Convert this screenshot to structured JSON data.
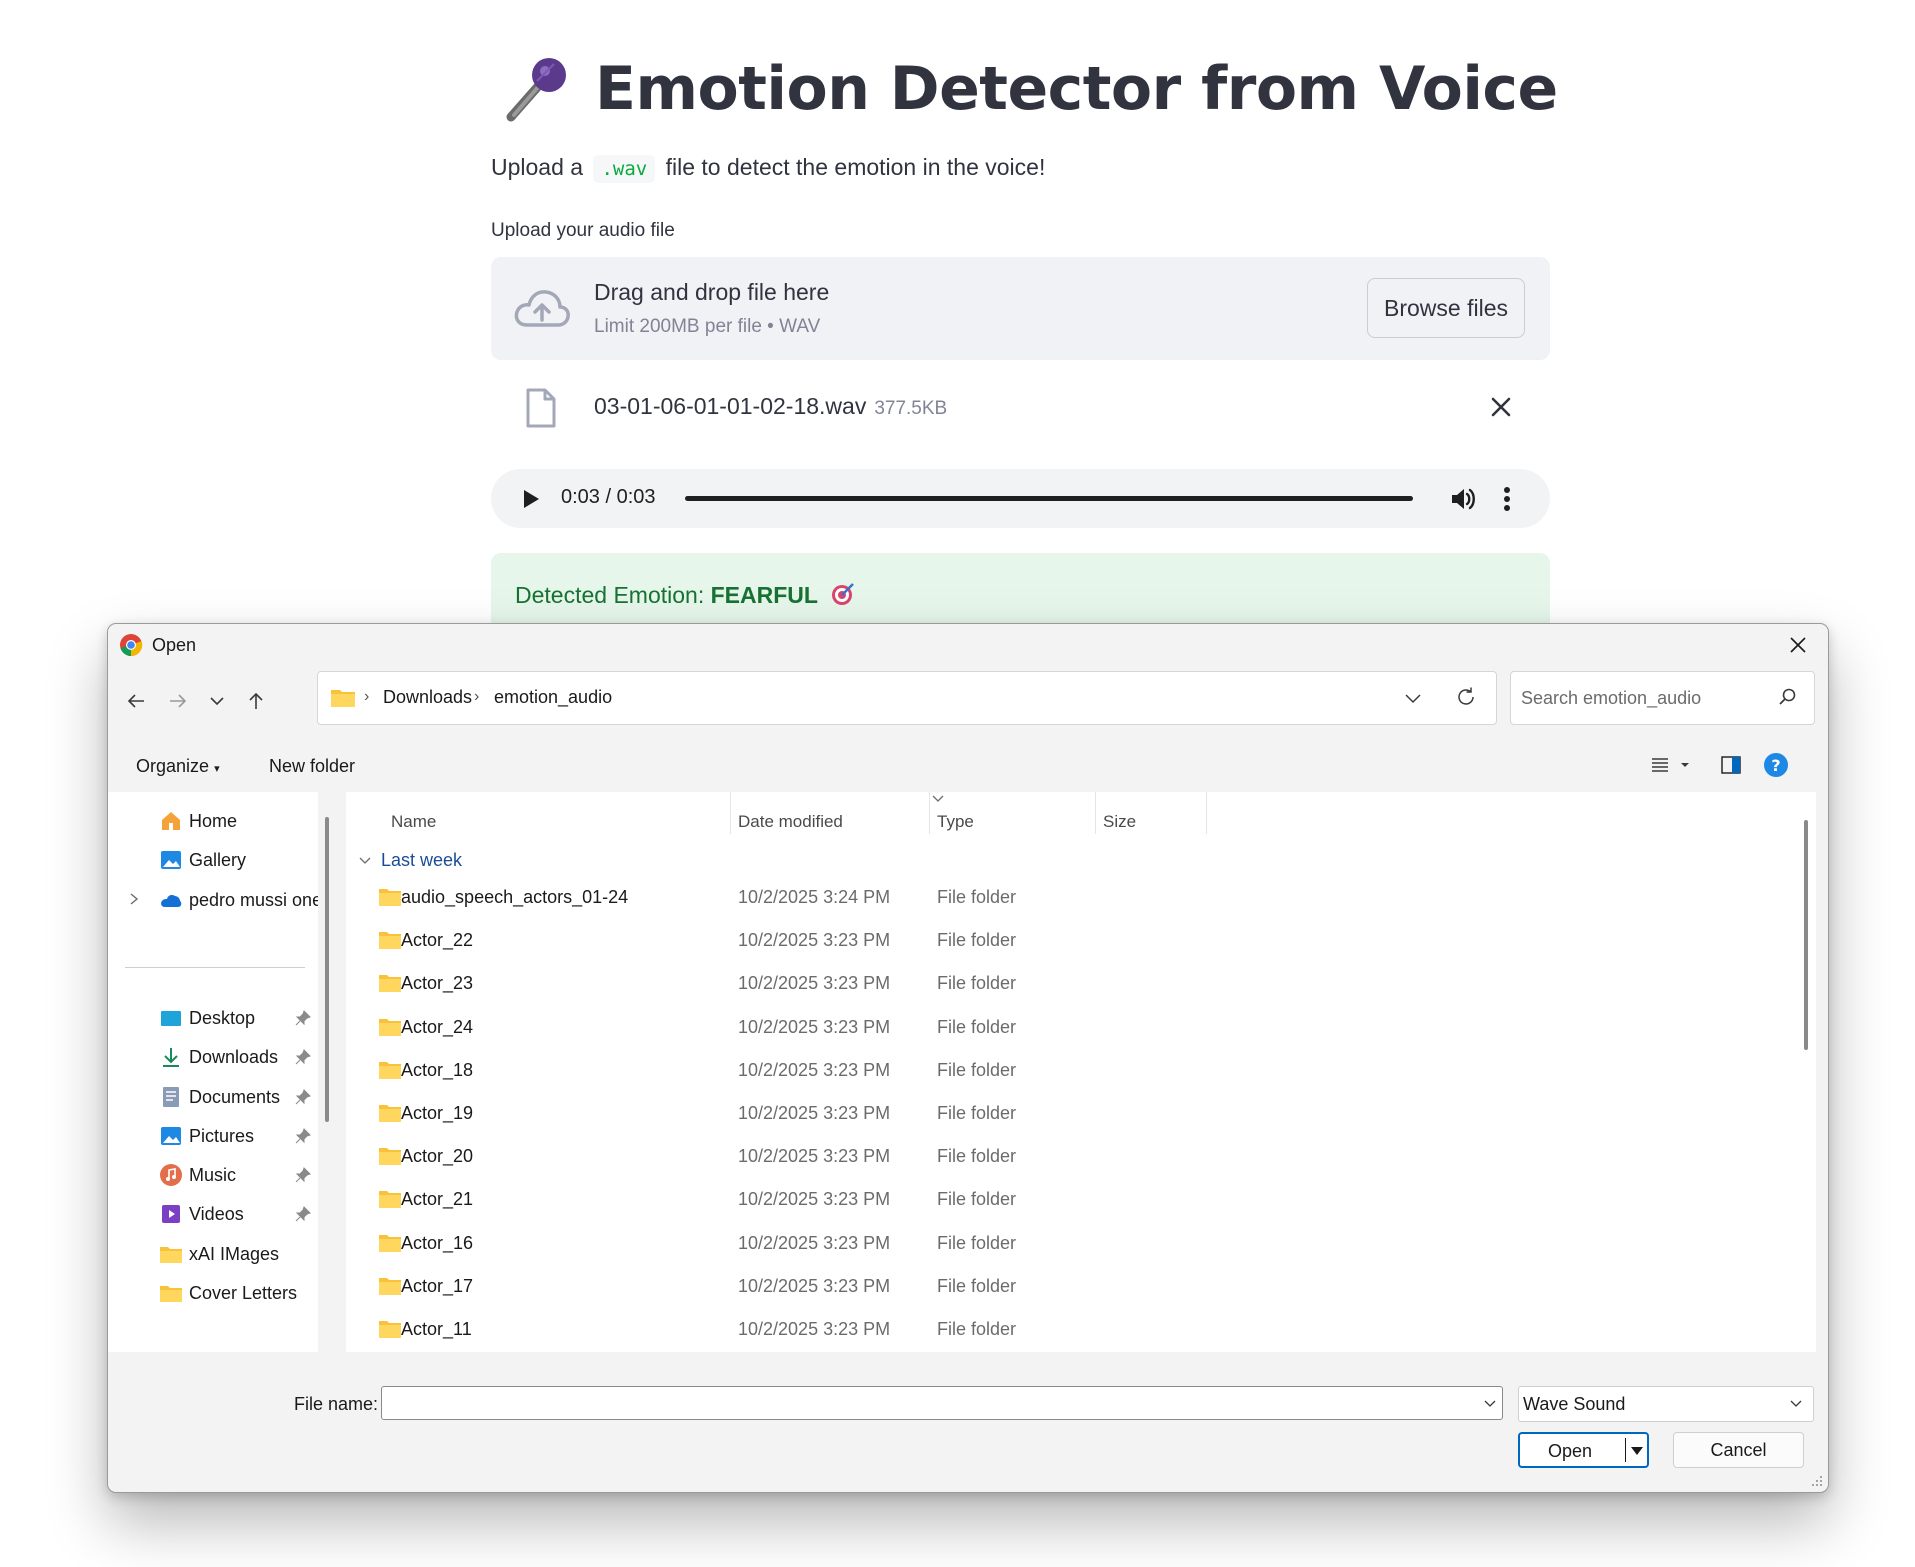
{
  "app": {
    "title": "Emotion Detector from Voice",
    "intro_before": "Upload a",
    "intro_code": ".wav",
    "intro_after": "file to detect the emotion in the voice!",
    "upload_label": "Upload your audio file",
    "dropzone": {
      "title": "Drag and drop file here",
      "subtitle": "Limit 200MB per file • WAV",
      "browse_label": "Browse files"
    },
    "uploaded_file": {
      "name": "03-01-06-01-01-02-18.wav",
      "size": "377.5KB"
    },
    "audio": {
      "time": "0:03 / 0:03",
      "progress": 1.0
    },
    "result": {
      "prefix": "Detected Emotion:",
      "emotion": "FEARFUL"
    }
  },
  "dialog": {
    "title": "Open",
    "breadcrumb": [
      "Downloads",
      "emotion_audio"
    ],
    "search_placeholder": "Search emotion_audio",
    "toolbar": {
      "organize": "Organize",
      "new_folder": "New folder"
    },
    "sidebar": {
      "items": [
        {
          "label": "Home",
          "icon": "home-icon"
        },
        {
          "label": "Gallery",
          "icon": "gallery-icon"
        },
        {
          "label": "pedro mussi one",
          "icon": "onedrive-icon"
        }
      ],
      "pinned": [
        {
          "label": "Desktop",
          "icon": "desktop-icon"
        },
        {
          "label": "Downloads",
          "icon": "downloads-icon"
        },
        {
          "label": "Documents",
          "icon": "documents-icon"
        },
        {
          "label": "Pictures",
          "icon": "pictures-icon"
        },
        {
          "label": "Music",
          "icon": "music-icon"
        },
        {
          "label": "Videos",
          "icon": "videos-icon"
        },
        {
          "label": "xAI IMages",
          "icon": "folder-icon"
        },
        {
          "label": "Cover Letters",
          "icon": "folder-icon"
        }
      ]
    },
    "columns": {
      "name": "Name",
      "date": "Date modified",
      "type": "Type",
      "size": "Size"
    },
    "group": "Last week",
    "rows": [
      {
        "name": "audio_speech_actors_01-24",
        "date": "10/2/2025 3:24 PM",
        "type": "File folder"
      },
      {
        "name": "Actor_22",
        "date": "10/2/2025 3:23 PM",
        "type": "File folder"
      },
      {
        "name": "Actor_23",
        "date": "10/2/2025 3:23 PM",
        "type": "File folder"
      },
      {
        "name": "Actor_24",
        "date": "10/2/2025 3:23 PM",
        "type": "File folder"
      },
      {
        "name": "Actor_18",
        "date": "10/2/2025 3:23 PM",
        "type": "File folder"
      },
      {
        "name": "Actor_19",
        "date": "10/2/2025 3:23 PM",
        "type": "File folder"
      },
      {
        "name": "Actor_20",
        "date": "10/2/2025 3:23 PM",
        "type": "File folder"
      },
      {
        "name": "Actor_21",
        "date": "10/2/2025 3:23 PM",
        "type": "File folder"
      },
      {
        "name": "Actor_16",
        "date": "10/2/2025 3:23 PM",
        "type": "File folder"
      },
      {
        "name": "Actor_17",
        "date": "10/2/2025 3:23 PM",
        "type": "File folder"
      },
      {
        "name": "Actor_11",
        "date": "10/2/2025 3:23 PM",
        "type": "File folder"
      }
    ],
    "file_name_label": "File name:",
    "file_name_value": "",
    "file_type": "Wave Sound",
    "open_label": "Open",
    "cancel_label": "Cancel"
  },
  "colors": {
    "title_text": "#31333f",
    "dropzone_bg": "#f0f2f6",
    "code_green": "#09ab3b",
    "success_bg": "#e6f6ea",
    "success_text": "#177233",
    "folder_yellow": "#f8c33a",
    "dialog_accent": "#0067c0"
  }
}
